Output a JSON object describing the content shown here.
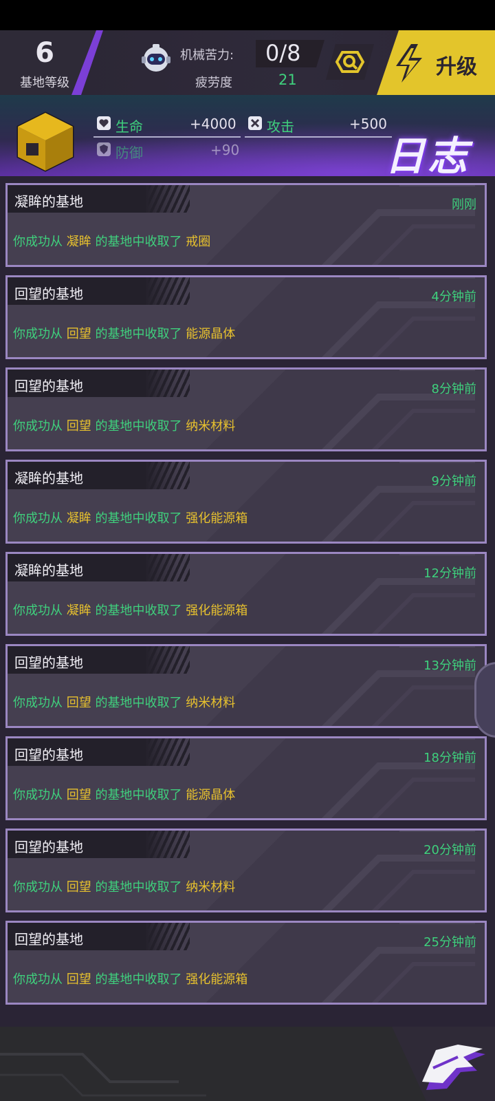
{
  "header": {
    "level_value": "6",
    "level_label": "基地等级",
    "mech_label": "机械苦力:",
    "mech_value": "0/8",
    "fatigue_label": "疲劳度",
    "fatigue_value": "21",
    "upgrade_label": "升级"
  },
  "banner": {
    "hp_label": "生命",
    "hp_value": "+4000",
    "atk_label": "攻击",
    "atk_value": "+500",
    "def_label": "防御",
    "def_value": "+90",
    "title": "日志"
  },
  "logs": [
    {
      "title": "凝眸的基地",
      "time": "刚刚",
      "prefix": "你成功从",
      "base": "凝眸",
      "middle": "的基地中收取了",
      "item": "戒圈"
    },
    {
      "title": "回望的基地",
      "time": "4分钟前",
      "prefix": "你成功从",
      "base": "回望",
      "middle": "的基地中收取了",
      "item": "能源晶体"
    },
    {
      "title": "回望的基地",
      "time": "8分钟前",
      "prefix": "你成功从",
      "base": "回望",
      "middle": "的基地中收取了",
      "item": "纳米材料"
    },
    {
      "title": "凝眸的基地",
      "time": "9分钟前",
      "prefix": "你成功从",
      "base": "凝眸",
      "middle": "的基地中收取了",
      "item": "强化能源箱"
    },
    {
      "title": "凝眸的基地",
      "time": "12分钟前",
      "prefix": "你成功从",
      "base": "凝眸",
      "middle": "的基地中收取了",
      "item": "强化能源箱"
    },
    {
      "title": "回望的基地",
      "time": "13分钟前",
      "prefix": "你成功从",
      "base": "回望",
      "middle": "的基地中收取了",
      "item": "纳米材料"
    },
    {
      "title": "回望的基地",
      "time": "18分钟前",
      "prefix": "你成功从",
      "base": "回望",
      "middle": "的基地中收取了",
      "item": "能源晶体"
    },
    {
      "title": "回望的基地",
      "time": "20分钟前",
      "prefix": "你成功从",
      "base": "回望",
      "middle": "的基地中收取了",
      "item": "纳米材料"
    },
    {
      "title": "回望的基地",
      "time": "25分钟前",
      "prefix": "你成功从",
      "base": "回望",
      "middle": "的基地中收取了",
      "item": "强化能源箱"
    }
  ],
  "colors": {
    "accent_purple": "#7b3fd6",
    "upgrade_yellow": "#e3c52b",
    "text_green": "#3fd07d",
    "text_yellow": "#e7c12e",
    "card_border": "#9b87c2"
  },
  "icons": {
    "robot": "robot-avatar-icon",
    "search": "search-icon",
    "upgrade": "lightning-icon",
    "hp": "heart-icon",
    "atk": "crossed-swords-icon",
    "def": "shield-icon",
    "back": "back-arrow-icon"
  }
}
